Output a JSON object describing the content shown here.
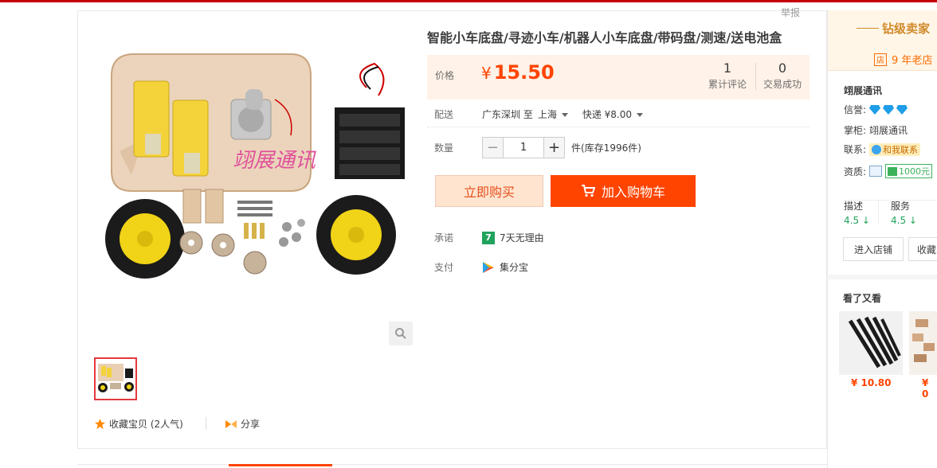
{
  "page": {
    "report_label": "举报"
  },
  "product": {
    "title": "智能小车底盘/寻迹小车/机器人小车底盘/带码盘/测速/送电池盒",
    "watermark": "翊展通讯",
    "price_label": "价格",
    "currency": "¥",
    "price": "15.50",
    "reviews_count": "1",
    "reviews_label": "累计评论",
    "sales_count": "0",
    "sales_label": "交易成功"
  },
  "delivery": {
    "label": "配送",
    "from": "广东深圳 至",
    "to": "上海",
    "method": "快递 ¥8.00"
  },
  "quantity": {
    "label": "数量",
    "minus": "−",
    "value": "1",
    "plus": "+",
    "stock": "件(库存1996件)"
  },
  "actions": {
    "buy_now": "立即购买",
    "add_to_cart": "加入购物车"
  },
  "promise": {
    "label": "承诺",
    "icon_text": "7",
    "text": "7天无理由"
  },
  "payment": {
    "label": "支付",
    "text": "集分宝"
  },
  "social": {
    "favorite": "收藏宝贝 (2人气)",
    "share": "分享"
  },
  "shop": {
    "level_title": "钻级卖家",
    "store_icon": "店",
    "store_age": "9 年老店",
    "name": "翊展通讯",
    "credit_label": "信誉:",
    "keeper_label": "掌柜:",
    "keeper": "翊展通讯",
    "contact_label": "联系:",
    "contact_text": "和我联系",
    "qual_label": "资质:",
    "deposit": "1000元",
    "desc_label": "描述",
    "desc_score": "4.5",
    "service_label": "服务",
    "service_score": "4.5",
    "enter_store": "进入店铺",
    "favorite_store": "收藏"
  },
  "recommend": {
    "title": "看了又看",
    "items": [
      {
        "price": "¥ 10.80"
      },
      {
        "price": "¥ 0"
      }
    ]
  },
  "colors": {
    "accent": "#ff4400",
    "brand_red": "#c40000",
    "price_bg": "#fff2e8",
    "good": "#22a35d"
  }
}
